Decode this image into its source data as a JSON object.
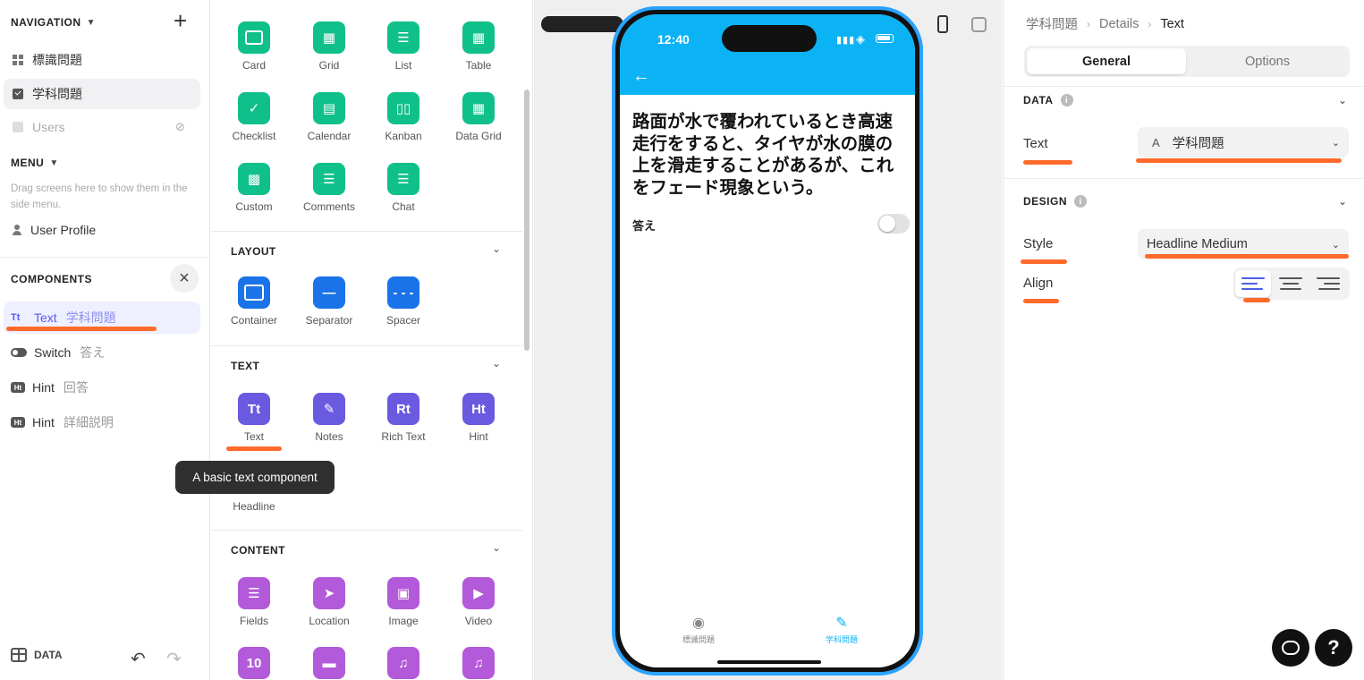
{
  "left": {
    "navigation_label": "NAVIGATION",
    "nav_items": [
      {
        "label": "標識問題",
        "icon": "grid-icon"
      },
      {
        "label": "学科問題",
        "icon": "check-icon",
        "active": true
      },
      {
        "label": "Users",
        "icon": "users-icon",
        "hidden": true
      }
    ],
    "menu_label": "MENU",
    "menu_hint": "Drag screens here to show them in the side menu.",
    "menu_items": [
      {
        "label": "User Profile",
        "icon": "user-icon"
      }
    ],
    "components_label": "COMPONENTS",
    "components": [
      {
        "type": "Text",
        "name": "学科問題",
        "badge": "Tt",
        "active": true
      },
      {
        "type": "Switch",
        "name": "答え",
        "badge": "switch"
      },
      {
        "type": "Hint",
        "name": "回答",
        "badge": "Ht"
      },
      {
        "type": "Hint",
        "name": "詳細説明",
        "badge": "Ht"
      }
    ],
    "data_label": "DATA"
  },
  "palette": {
    "collections": [
      {
        "label": "Card"
      },
      {
        "label": "Grid"
      },
      {
        "label": "List"
      },
      {
        "label": "Table"
      },
      {
        "label": "Checklist"
      },
      {
        "label": "Calendar"
      },
      {
        "label": "Kanban"
      },
      {
        "label": "Data Grid"
      },
      {
        "label": "Custom"
      },
      {
        "label": "Comments"
      },
      {
        "label": "Chat"
      }
    ],
    "layout_label": "LAYOUT",
    "layout": [
      {
        "label": "Container"
      },
      {
        "label": "Separator"
      },
      {
        "label": "Spacer"
      }
    ],
    "text_label": "TEXT",
    "text": [
      {
        "label": "Text",
        "glyph": "Tt"
      },
      {
        "label": "Notes",
        "glyph": ""
      },
      {
        "label": "Rich Text",
        "glyph": "Rt"
      },
      {
        "label": "Hint",
        "glyph": "Ht"
      },
      {
        "label": "Headline",
        "glyph": ""
      }
    ],
    "content_label": "CONTENT",
    "content": [
      {
        "label": "Fields"
      },
      {
        "label": "Location"
      },
      {
        "label": "Image"
      },
      {
        "label": "Video"
      }
    ],
    "content_row2_glyph": "10",
    "tooltip": "A basic text component"
  },
  "phone": {
    "time": "12:40",
    "headline": "路面が水で覆われているとき高速走行をすると、タイヤが水の膜の上を滑走することがあるが、これをフェード現象という。",
    "switch_label": "答え",
    "tabs": [
      {
        "label": "標識問題",
        "icon": "eye-icon",
        "active": false
      },
      {
        "label": "学科問題",
        "icon": "pencil-icon",
        "active": true
      }
    ]
  },
  "inspector": {
    "breadcrumb": [
      "学科問題",
      "Details",
      "Text"
    ],
    "tabs": [
      "General",
      "Options"
    ],
    "data_section": "DATA",
    "text_label": "Text",
    "text_value": "学科問題",
    "design_section": "DESIGN",
    "style_label": "Style",
    "style_value": "Headline Medium",
    "align_label": "Align",
    "align_selected": "left"
  },
  "colors": {
    "accent": "#5a5ae8",
    "app_header": "#0bb3f5",
    "annotation": "#ff6a2b",
    "green_tile": "#10c08a",
    "blue_tile": "#1a73e8",
    "violet_tile": "#6a5ae0",
    "purple_tile": "#b25ad9"
  }
}
